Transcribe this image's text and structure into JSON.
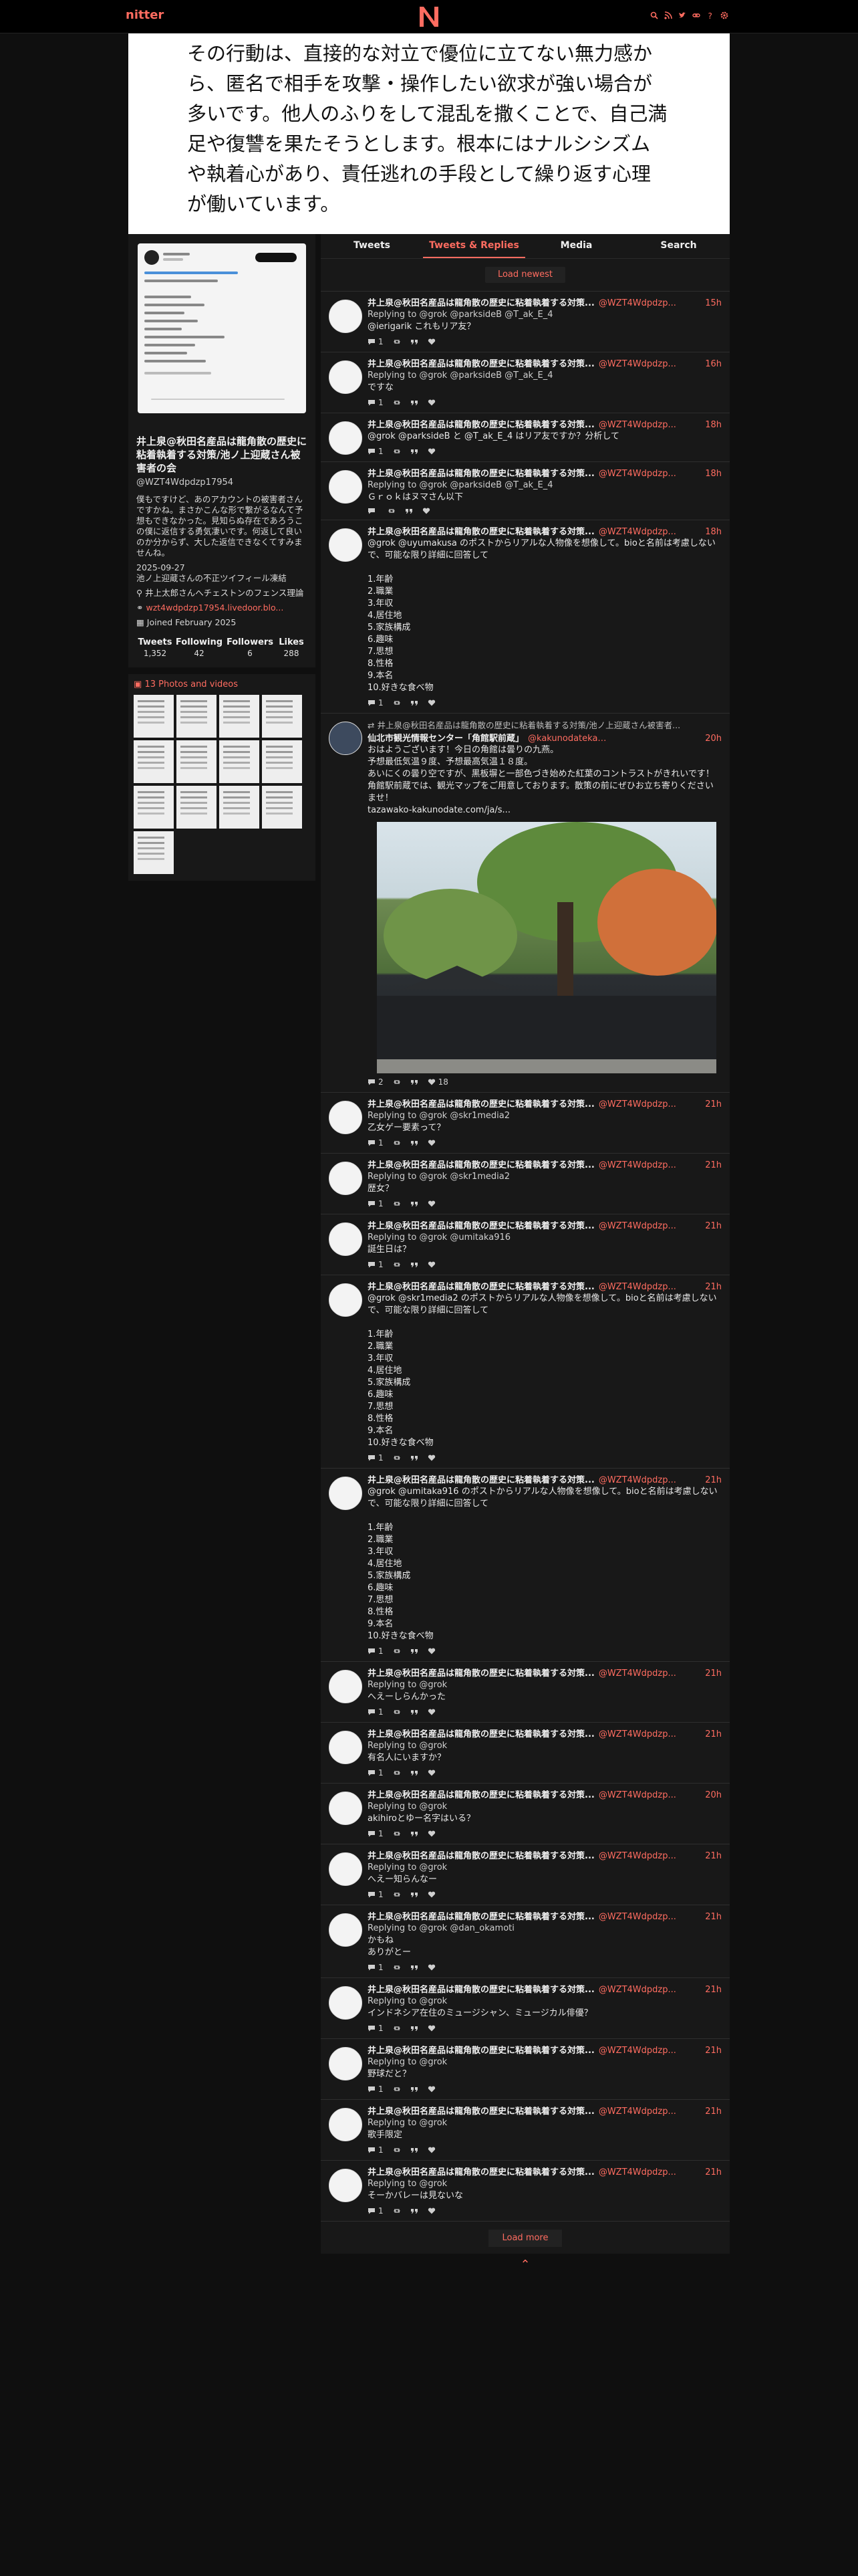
{
  "nav": {
    "brand": "nitter",
    "colors": {
      "accent": "#ff6c60",
      "background": "#0f0f0f",
      "panel": "#181818"
    },
    "icons": [
      "search-icon",
      "rss-icon",
      "twitter-icon",
      "link-icon",
      "question-icon",
      "gear-icon"
    ]
  },
  "banner": {
    "text": "その行動は、直接的な対立で優位に立てない無力感から、匿名で相手を攻撃・操作したい欲求が強い場合が多いです。他人のふりをして混乱を撒くことで、自己満足や復讐を果たそうとします。根本にはナルシシズムや執着心があり、責任逃れの手段として繰り返す心理が働いています。"
  },
  "profile": {
    "name": "井上泉@秋田名産品は龍角散の歴史に粘着執着する対策/池ノ上迎蔵さん被害者の会",
    "handle": "@WZT4Wdpdzp17954",
    "bio": "僕もですけど、あのアカウントの被害者さんですかね。まさかこんな形で繋がるなんて予想もできなかった。見知らぬ存在であろうこの僕に返信する勇気凄いです。何返して良いのか分からず、大した返信できなくてすみませんね。",
    "date": "2025-09-27",
    "note": "池ノ上迎蔵さんの不正ツイフィール凍結",
    "location": "井上太郎さんへチェストンのフェンス理論",
    "website": "wzt4wdpdzp17954.livedoor.blo...",
    "joined": "Joined February 2025",
    "stats": [
      {
        "label": "Tweets",
        "value": "1,352"
      },
      {
        "label": "Following",
        "value": "42"
      },
      {
        "label": "Followers",
        "value": "6"
      },
      {
        "label": "Likes",
        "value": "288"
      }
    ],
    "photos_label": "13 Photos and videos"
  },
  "tabs": [
    "Tweets",
    "Tweets & Replies",
    "Media",
    "Search"
  ],
  "load_newest": "Load newest",
  "load_more": "Load more",
  "tweets": [
    {
      "name": "井上泉@秋田名産品は龍角散の歴史に粘着執着する対策...",
      "handle": "@WZT4Wdpdzp...",
      "time": "15h",
      "reply": "Replying to @grok @parksideB @T_ak_E_4",
      "body": "@ierigarik これもリア友？",
      "stats": [
        "1",
        "",
        ""
      ]
    },
    {
      "name": "井上泉@秋田名産品は龍角散の歴史に粘着執着する対策...",
      "handle": "@WZT4Wdpdzp...",
      "time": "16h",
      "reply": "Replying to @grok @parksideB @T_ak_E_4",
      "body": "ですな",
      "stats": [
        "1",
        "",
        ""
      ]
    },
    {
      "name": "井上泉@秋田名産品は龍角散の歴史に粘着執着する対策...",
      "handle": "@WZT4Wdpdzp...",
      "time": "18h",
      "reply": "",
      "body": "@grok @parksideB と @T_ak_E_4 はリア友ですか？分析して",
      "stats": [
        "1",
        "",
        ""
      ]
    },
    {
      "name": "井上泉@秋田名産品は龍角散の歴史に粘着執着する対策...",
      "handle": "@WZT4Wdpdzp...",
      "time": "18h",
      "reply": "Replying to @grok @parksideB @T_ak_E_4",
      "body": "Ｇｒｏｋはヌマさん以下",
      "stats": [
        "",
        "",
        ""
      ]
    },
    {
      "name": "井上泉@秋田名産品は龍角散の歴史に粘着執着する対策...",
      "handle": "@WZT4Wdpdzp...",
      "time": "18h",
      "reply": "",
      "body": "@grok @uyumakusa のポストからリアルな人物像を想像して。bioと名前は考慮しないで、可能な限り詳細に回答して\n\n1.年齢\n2.職業\n3.年収\n4.居住地\n5.家族構成\n6.趣味\n7.思想\n8.性格\n9.本名\n10.好きな食べ物",
      "stats": [
        "1",
        "",
        ""
      ]
    },
    {
      "retweet": "井上泉@秋田名産品は龍角散の歴史に粘着執着する対策/池ノ上迎蔵さん被害者...",
      "name": "仙北市観光情報センター「角館駅前蔵」",
      "handle": "@kakunodatekanko",
      "time": "20h",
      "reply": "",
      "body": "おはようございます！今日の角館は曇りの九燕。\n予想最低気温９度、予想最高気温１８度。\nあいにくの曇り空ですが、黒板塀と一部色づき始めた紅葉のコントラストがきれいです！\n角館駅前蔵では、観光マップをご用意しております。散策の前にぜひお立ち寄りくださいませ！\ntazawako-kakunodate.com/ja/s...",
      "photo": true,
      "camp": true,
      "stats": [
        "2",
        "",
        "18"
      ]
    },
    {
      "name": "井上泉@秋田名産品は龍角散の歴史に粘着執着する対策...",
      "handle": "@WZT4Wdpdzp...",
      "time": "21h",
      "reply": "Replying to @grok @skr1media2",
      "body": "乙女ゲー要素って？",
      "stats": [
        "1",
        "",
        ""
      ]
    },
    {
      "name": "井上泉@秋田名産品は龍角散の歴史に粘着執着する対策...",
      "handle": "@WZT4Wdpdzp...",
      "time": "21h",
      "reply": "Replying to @grok @skr1media2",
      "body": "歴女？",
      "stats": [
        "1",
        "",
        ""
      ]
    },
    {
      "name": "井上泉@秋田名産品は龍角散の歴史に粘着執着する対策...",
      "handle": "@WZT4Wdpdzp...",
      "time": "21h",
      "reply": "Replying to @grok @umitaka916",
      "body": "誕生日は？",
      "stats": [
        "1",
        "",
        ""
      ]
    },
    {
      "name": "井上泉@秋田名産品は龍角散の歴史に粘着執着する対策...",
      "handle": "@WZT4Wdpdzp...",
      "time": "21h",
      "reply": "",
      "body": "@grok @skr1media2 のポストからリアルな人物像を想像して。bioと名前は考慮しないで、可能な限り詳細に回答して\n\n1.年齢\n2.職業\n3.年収\n4.居住地\n5.家族構成\n6.趣味\n7.思想\n8.性格\n9.本名\n10.好きな食べ物",
      "stats": [
        "1",
        "",
        ""
      ]
    },
    {
      "name": "井上泉@秋田名産品は龍角散の歴史に粘着執着する対策...",
      "handle": "@WZT4Wdpdzp...",
      "time": "21h",
      "reply": "",
      "body": "@grok @umitaka916 のポストからリアルな人物像を想像して。bioと名前は考慮しないで、可能な限り詳細に回答して\n\n1.年齢\n2.職業\n3.年収\n4.居住地\n5.家族構成\n6.趣味\n7.思想\n8.性格\n9.本名\n10.好きな食べ物",
      "stats": [
        "1",
        "",
        ""
      ]
    },
    {
      "name": "井上泉@秋田名産品は龍角散の歴史に粘着執着する対策...",
      "handle": "@WZT4Wdpdzp...",
      "time": "21h",
      "reply": "Replying to @grok",
      "body": "へえーしらんかった",
      "stats": [
        "1",
        "",
        ""
      ]
    },
    {
      "name": "井上泉@秋田名産品は龍角散の歴史に粘着執着する対策...",
      "handle": "@WZT4Wdpdzp...",
      "time": "21h",
      "reply": "Replying to @grok",
      "body": "有名人にいますか？",
      "stats": [
        "1",
        "",
        ""
      ]
    },
    {
      "name": "井上泉@秋田名産品は龍角散の歴史に粘着執着する対策...",
      "handle": "@WZT4Wdpdzp...",
      "time": "20h",
      "reply": "Replying to @grok",
      "body": "akihiroとゆー名字はいる？",
      "stats": [
        "1",
        "",
        ""
      ]
    },
    {
      "name": "井上泉@秋田名産品は龍角散の歴史に粘着執着する対策...",
      "handle": "@WZT4Wdpdzp...",
      "time": "21h",
      "reply": "Replying to @grok",
      "body": "へえー知らんなー",
      "stats": [
        "1",
        "",
        ""
      ]
    },
    {
      "name": "井上泉@秋田名産品は龍角散の歴史に粘着執着する対策...",
      "handle": "@WZT4Wdpdzp...",
      "time": "21h",
      "reply": "Replying to @grok @dan_okamoti",
      "body": "かもね\nありがとー",
      "stats": [
        "1",
        "",
        ""
      ]
    },
    {
      "name": "井上泉@秋田名産品は龍角散の歴史に粘着執着する対策...",
      "handle": "@WZT4Wdpdzp...",
      "time": "21h",
      "reply": "Replying to @grok",
      "body": "インドネシア在住のミュージシャン、ミュージカル俳優？",
      "stats": [
        "1",
        "",
        ""
      ]
    },
    {
      "name": "井上泉@秋田名産品は龍角散の歴史に粘着執着する対策...",
      "handle": "@WZT4Wdpdzp...",
      "time": "21h",
      "reply": "Replying to @grok",
      "body": "野球だと？",
      "stats": [
        "1",
        "",
        ""
      ]
    },
    {
      "name": "井上泉@秋田名産品は龍角散の歴史に粘着執着する対策...",
      "handle": "@WZT4Wdpdzp...",
      "time": "21h",
      "reply": "Replying to @grok",
      "body": "歌手限定",
      "stats": [
        "1",
        "",
        ""
      ]
    },
    {
      "name": "井上泉@秋田名産品は龍角散の歴史に粘着執着する対策...",
      "handle": "@WZT4Wdpdzp...",
      "time": "21h",
      "reply": "Replying to @grok",
      "body": "そーかバレーは見ないな",
      "stats": [
        "1",
        "",
        ""
      ]
    }
  ]
}
